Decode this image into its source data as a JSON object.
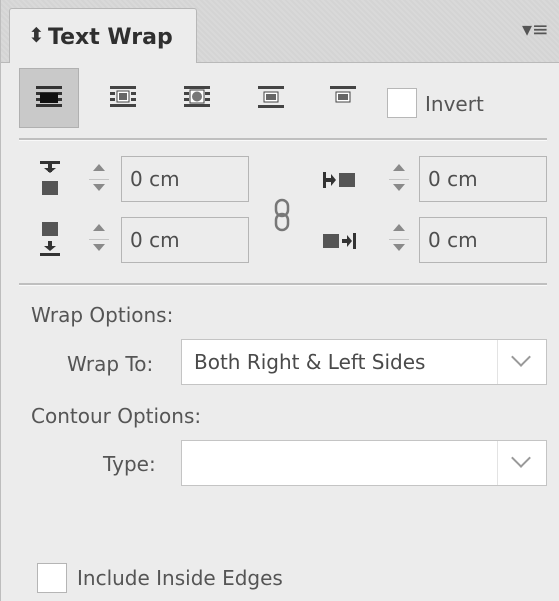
{
  "panel": {
    "title": "Text Wrap",
    "arrows_glyph": "⬍",
    "menu_glyph": "▾≡"
  },
  "wrap_modes": [
    {
      "name": "no-text-wrap-icon",
      "active": true
    },
    {
      "name": "wrap-around-bounding-box-icon",
      "active": false
    },
    {
      "name": "wrap-around-object-shape-icon",
      "active": false
    },
    {
      "name": "jump-object-icon",
      "active": false
    },
    {
      "name": "jump-to-next-column-icon",
      "active": false
    }
  ],
  "invert": {
    "label": "Invert",
    "checked": false
  },
  "offsets": {
    "top": "0 cm",
    "bottom": "0 cm",
    "left": "0 cm",
    "right": "0 cm",
    "linked": true
  },
  "wrap_options": {
    "heading": "Wrap Options:",
    "wrap_to_label": "Wrap To:",
    "wrap_to_value": "Both Right & Left Sides"
  },
  "contour_options": {
    "heading": "Contour Options:",
    "type_label": "Type:",
    "type_value": ""
  },
  "include_inside_edges": {
    "label": "Include Inside Edges",
    "checked": false
  }
}
